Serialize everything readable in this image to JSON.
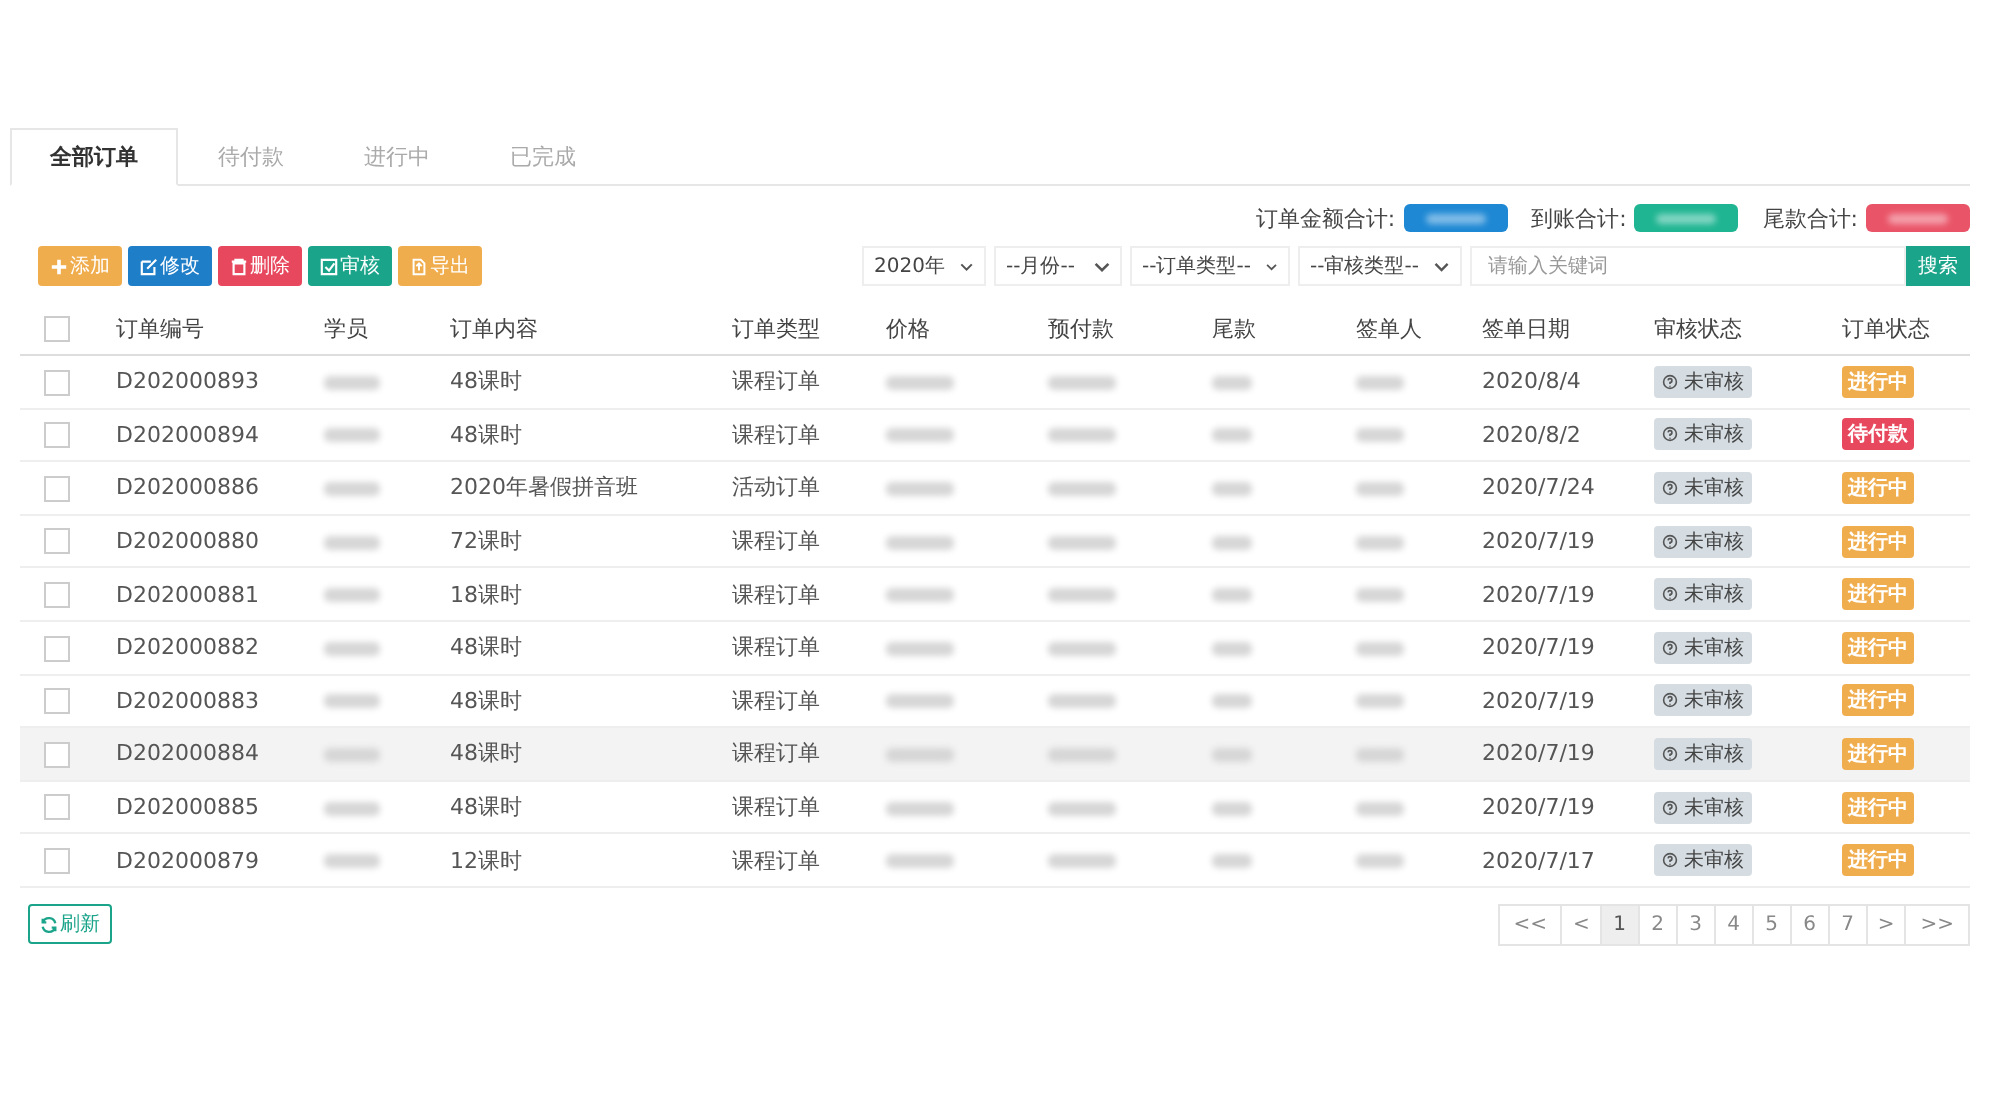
{
  "tabs": [
    {
      "label": "全部订单",
      "selected": true
    },
    {
      "label": "待付款",
      "selected": false
    },
    {
      "label": "进行中",
      "selected": false
    },
    {
      "label": "已完成",
      "selected": false
    }
  ],
  "summary": [
    {
      "label": "订单金额合计:",
      "color": "#1e88d4"
    },
    {
      "label": "到账合计:",
      "color": "#1fb592"
    },
    {
      "label": "尾款合计:",
      "color": "#ea5468"
    }
  ],
  "actions": [
    {
      "label": "添加",
      "kind": "add",
      "color": "#f0ad4e"
    },
    {
      "label": "修改",
      "kind": "edit",
      "color": "#1f7ec8"
    },
    {
      "label": "删除",
      "kind": "delete",
      "color": "#e8485e"
    },
    {
      "label": "审核",
      "kind": "audit",
      "color": "#1aa48a"
    },
    {
      "label": "导出",
      "kind": "export",
      "color": "#f0ad4e"
    }
  ],
  "filters": [
    {
      "value": "2020年"
    },
    {
      "value": "--月份--"
    },
    {
      "value": "--订单类型--"
    },
    {
      "value": "--审核类型--"
    }
  ],
  "search": {
    "placeholder": "请输入关键词",
    "button": "搜索"
  },
  "table": {
    "select_all": {
      "checked": false
    },
    "columns": [
      {
        "label": "订单编号",
        "blurred": false
      },
      {
        "label": "学员",
        "blurred": true
      },
      {
        "label": "订单内容",
        "blurred": false
      },
      {
        "label": "订单类型",
        "blurred": false
      },
      {
        "label": "价格",
        "blurred": true
      },
      {
        "label": "预付款",
        "blurred": true
      },
      {
        "label": "尾款",
        "blurred": true
      },
      {
        "label": "签单人",
        "blurred": true
      },
      {
        "label": "签单日期",
        "blurred": false
      },
      {
        "label": "审核状态",
        "blurred": false
      },
      {
        "label": "订单状态",
        "blurred": false
      }
    ],
    "rows": [
      {
        "checked": false,
        "highlighted": false,
        "cells": [
          "D202000893",
          null,
          "48课时",
          "课程订单",
          null,
          null,
          null,
          null,
          "2020/8/4"
        ],
        "audit": "未审核",
        "status": {
          "text": "进行中",
          "color": "#f0ad4e"
        }
      },
      {
        "checked": false,
        "highlighted": false,
        "cells": [
          "D202000894",
          null,
          "48课时",
          "课程订单",
          null,
          null,
          null,
          null,
          "2020/8/2"
        ],
        "audit": "未审核",
        "status": {
          "text": "待付款",
          "color": "#e8485e"
        }
      },
      {
        "checked": false,
        "highlighted": false,
        "cells": [
          "D202000886",
          null,
          "2020年暑假拼音班",
          "活动订单",
          null,
          null,
          null,
          null,
          "2020/7/24"
        ],
        "audit": "未审核",
        "status": {
          "text": "进行中",
          "color": "#f0ad4e"
        }
      },
      {
        "checked": false,
        "highlighted": false,
        "cells": [
          "D202000880",
          null,
          "72课时",
          "课程订单",
          null,
          null,
          null,
          null,
          "2020/7/19"
        ],
        "audit": "未审核",
        "status": {
          "text": "进行中",
          "color": "#f0ad4e"
        }
      },
      {
        "checked": false,
        "highlighted": false,
        "cells": [
          "D202000881",
          null,
          "18课时",
          "课程订单",
          null,
          null,
          null,
          null,
          "2020/7/19"
        ],
        "audit": "未审核",
        "status": {
          "text": "进行中",
          "color": "#f0ad4e"
        }
      },
      {
        "checked": false,
        "highlighted": false,
        "cells": [
          "D202000882",
          null,
          "48课时",
          "课程订单",
          null,
          null,
          null,
          null,
          "2020/7/19"
        ],
        "audit": "未审核",
        "status": {
          "text": "进行中",
          "color": "#f0ad4e"
        }
      },
      {
        "checked": false,
        "highlighted": false,
        "cells": [
          "D202000883",
          null,
          "48课时",
          "课程订单",
          null,
          null,
          null,
          null,
          "2020/7/19"
        ],
        "audit": "未审核",
        "status": {
          "text": "进行中",
          "color": "#f0ad4e"
        }
      },
      {
        "checked": false,
        "highlighted": true,
        "cells": [
          "D202000884",
          null,
          "48课时",
          "课程订单",
          null,
          null,
          null,
          null,
          "2020/7/19"
        ],
        "audit": "未审核",
        "status": {
          "text": "进行中",
          "color": "#f0ad4e"
        }
      },
      {
        "checked": false,
        "highlighted": false,
        "cells": [
          "D202000885",
          null,
          "48课时",
          "课程订单",
          null,
          null,
          null,
          null,
          "2020/7/19"
        ],
        "audit": "未审核",
        "status": {
          "text": "进行中",
          "color": "#f0ad4e"
        }
      },
      {
        "checked": false,
        "highlighted": false,
        "cells": [
          "D202000879",
          null,
          "12课时",
          "课程订单",
          null,
          null,
          null,
          null,
          "2020/7/17"
        ],
        "audit": "未审核",
        "status": {
          "text": "进行中",
          "color": "#f0ad4e"
        }
      }
    ]
  },
  "refresh": "刷新",
  "pagination": [
    {
      "label": "<<",
      "selected": false
    },
    {
      "label": "<",
      "selected": false
    },
    {
      "label": "1",
      "selected": true
    },
    {
      "label": "2",
      "selected": false
    },
    {
      "label": "3",
      "selected": false
    },
    {
      "label": "4",
      "selected": false
    },
    {
      "label": "5",
      "selected": false
    },
    {
      "label": "6",
      "selected": false
    },
    {
      "label": "7",
      "selected": false
    },
    {
      "label": ">",
      "selected": false
    },
    {
      "label": ">>",
      "selected": false
    }
  ]
}
